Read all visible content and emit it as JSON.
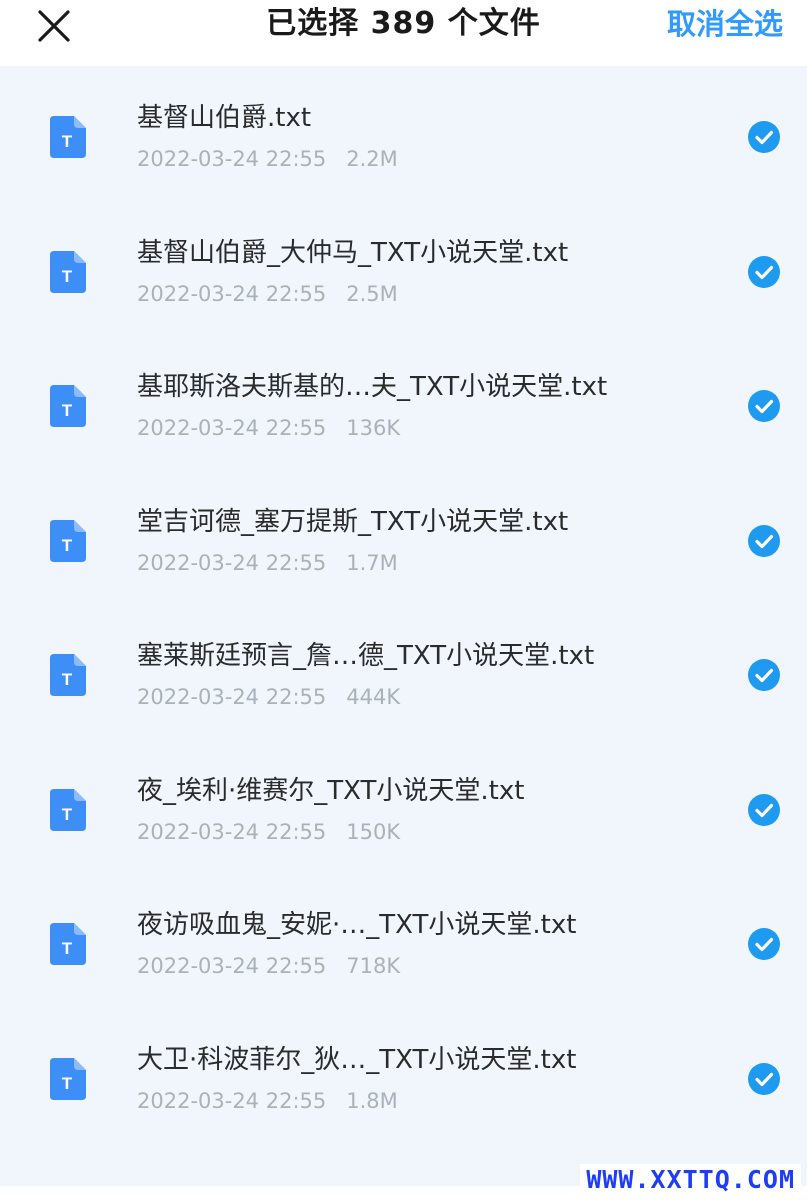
{
  "header": {
    "title": "已选择 389 个文件",
    "deselect_all": "取消全选",
    "close_icon": "close-icon"
  },
  "files": [
    {
      "name": "基督山伯爵.txt",
      "date": "2022-03-24 22:55",
      "size": "2.2M",
      "selected": true
    },
    {
      "name": "基督山伯爵_大仲马_TXT小说天堂.txt",
      "date": "2022-03-24 22:55",
      "size": "2.5M",
      "selected": true
    },
    {
      "name": "基耶斯洛夫斯基的…夫_TXT小说天堂.txt",
      "date": "2022-03-24 22:55",
      "size": "136K",
      "selected": true
    },
    {
      "name": "堂吉诃德_塞万提斯_TXT小说天堂.txt",
      "date": "2022-03-24 22:55",
      "size": "1.7M",
      "selected": true
    },
    {
      "name": "塞莱斯廷预言_詹…德_TXT小说天堂.txt",
      "date": "2022-03-24 22:55",
      "size": "444K",
      "selected": true
    },
    {
      "name": "夜_埃利·维赛尔_TXT小说天堂.txt",
      "date": "2022-03-24 22:55",
      "size": "150K",
      "selected": true
    },
    {
      "name": "夜访吸血鬼_安妮·…_TXT小说天堂.txt",
      "date": "2022-03-24 22:55",
      "size": "718K",
      "selected": true
    },
    {
      "name": "大卫·科波菲尔_狄…_TXT小说天堂.txt",
      "date": "2022-03-24 22:55",
      "size": "1.8M",
      "selected": true
    }
  ],
  "watermark": "WWW.XXTTQ.COM",
  "colors": {
    "accent": "#2f9bff",
    "check": "#1e9bf0",
    "file_icon": "#3d8ef6",
    "background": "#f1f6fc"
  }
}
